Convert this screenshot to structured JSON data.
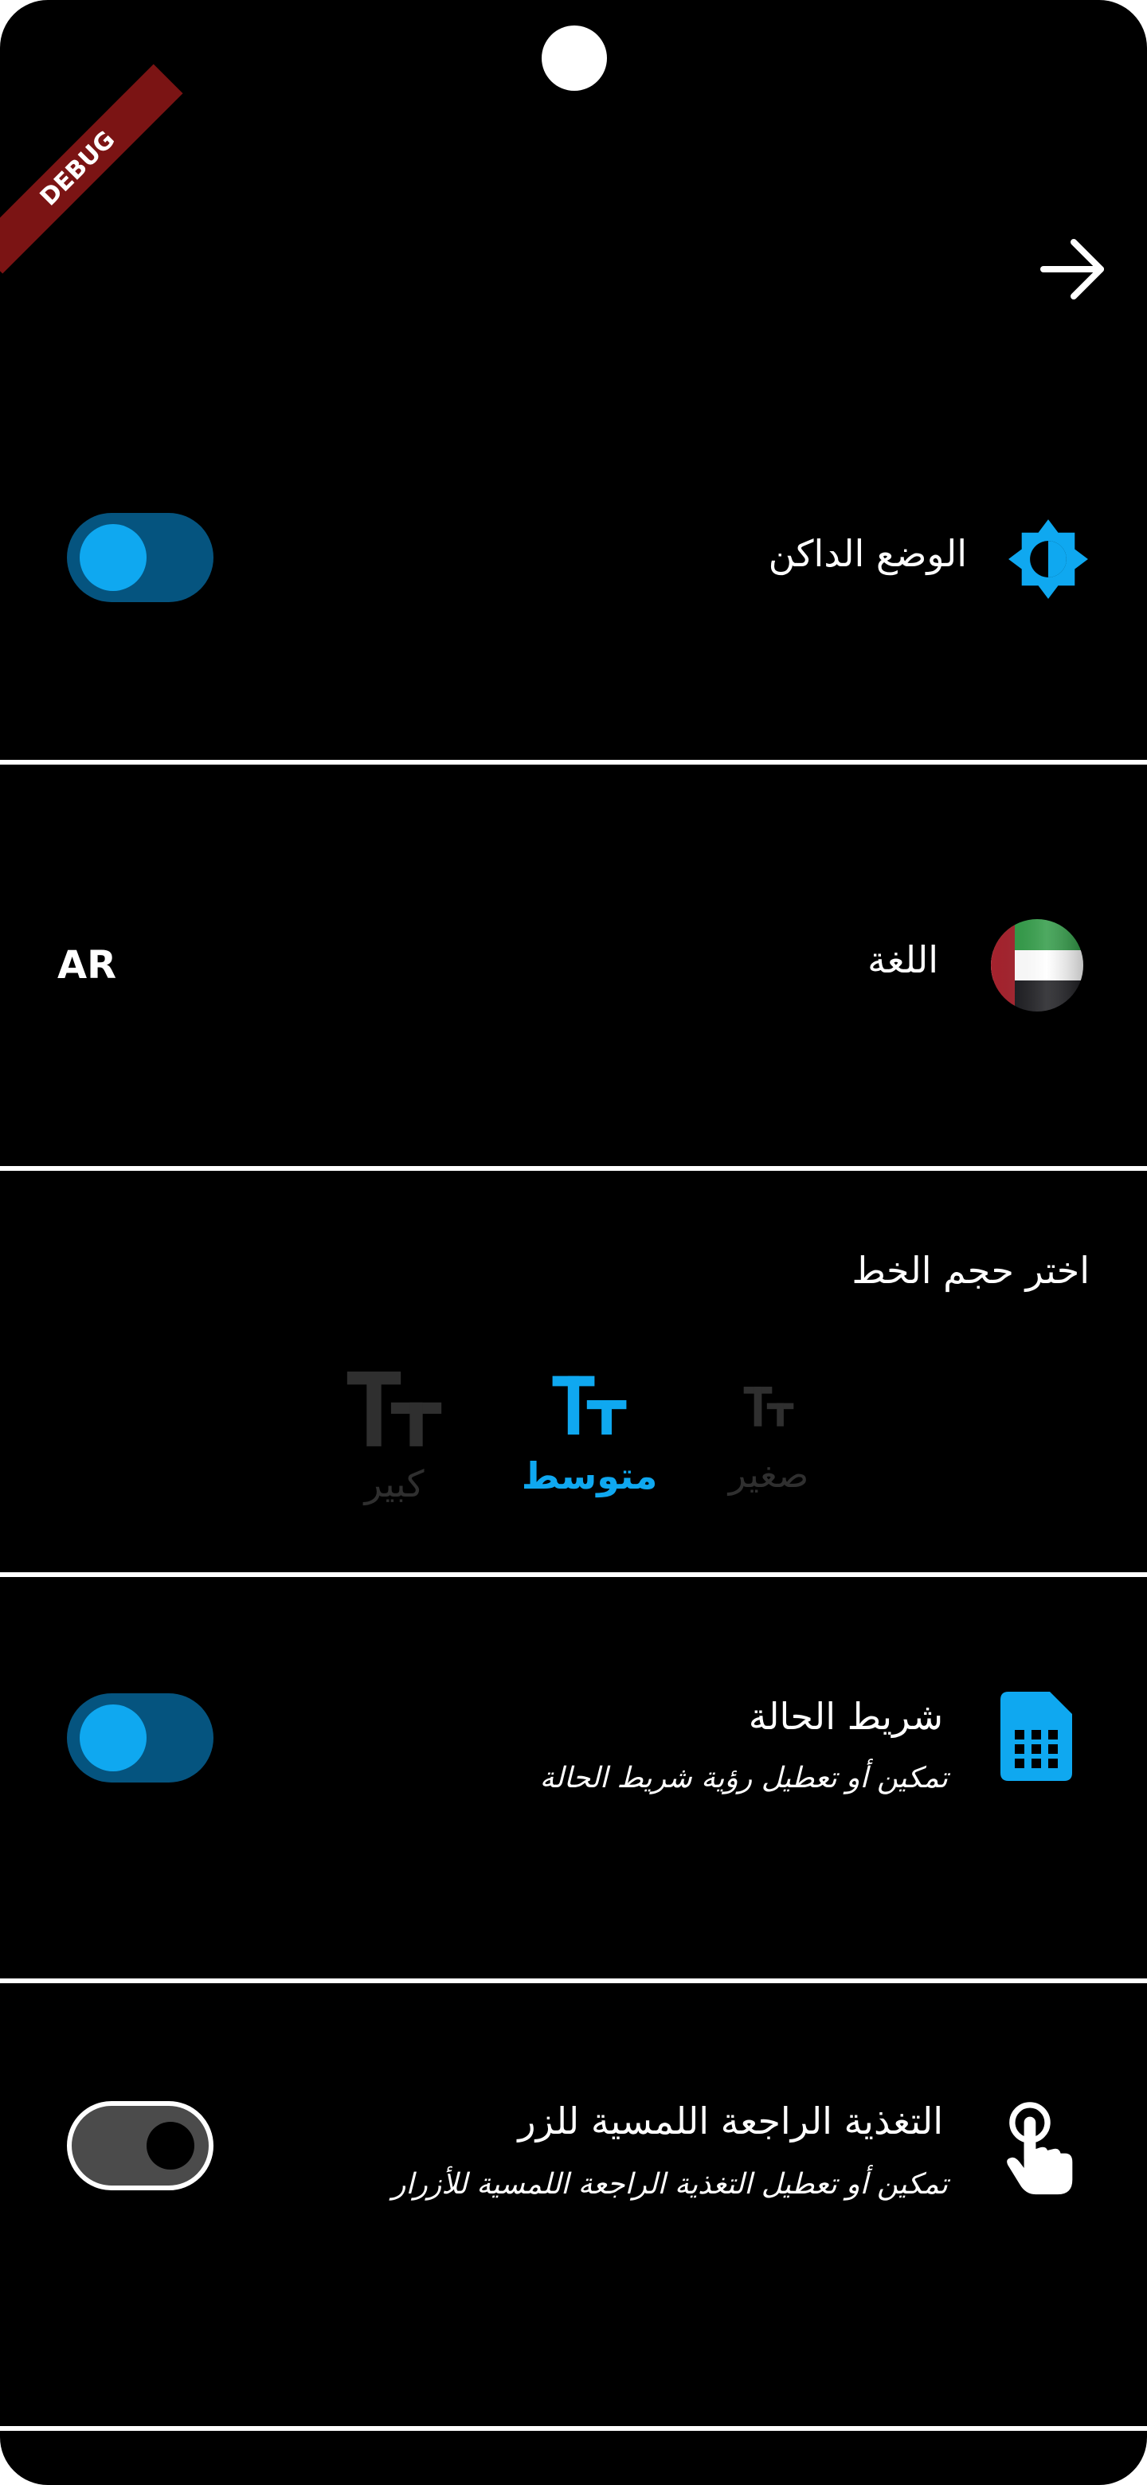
{
  "debug_banner": "DEBUG",
  "colors": {
    "accent": "#0fa8f0",
    "toggle_track_on": "#05547f",
    "inactive_text": "#2f2f2f",
    "background": "#000000"
  },
  "settings": {
    "dark_mode": {
      "label": "الوضع الداكن",
      "icon": "brightness-icon",
      "enabled": true
    },
    "language": {
      "label": "اللغة",
      "code": "AR",
      "icon": "uae-flag-icon"
    },
    "font_size": {
      "title": "اختر حجم الخط",
      "selected": "medium",
      "options": [
        {
          "key": "large",
          "glyph": "TT",
          "label": "كبير"
        },
        {
          "key": "medium",
          "glyph": "TT",
          "label": "متوسط"
        },
        {
          "key": "small",
          "glyph": "TT",
          "label": "صغير"
        }
      ]
    },
    "status_bar": {
      "label": "شريط الحالة",
      "description": "تمكين أو تعطيل رؤية شريط الحالة",
      "icon": "sim-card-icon",
      "enabled": true
    },
    "haptic_feedback": {
      "label": "التغذية الراجعة اللمسية للزر",
      "description": "تمكين أو تعطيل التغذية الراجعة اللمسية للأزرار",
      "icon": "touch-icon",
      "enabled": false
    }
  }
}
